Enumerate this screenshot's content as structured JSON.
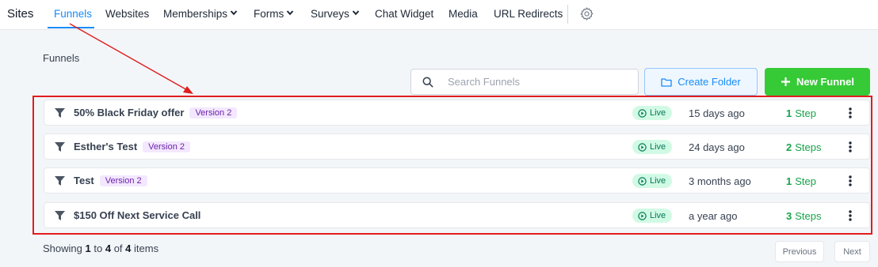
{
  "nav": {
    "brand": "Sites",
    "items": [
      {
        "label": "Funnels"
      },
      {
        "label": "Websites"
      },
      {
        "label": "Memberships"
      },
      {
        "label": "Forms"
      },
      {
        "label": "Surveys"
      },
      {
        "label": "Chat Widget"
      },
      {
        "label": "Media"
      },
      {
        "label": "URL Redirects"
      }
    ]
  },
  "section_title": "Funnels",
  "search": {
    "placeholder": "Search Funnels"
  },
  "buttons": {
    "create_folder": "Create Folder",
    "new_funnel": "New Funnel"
  },
  "funnels": [
    {
      "name": "50% Black Friday offer",
      "version": "Version 2",
      "status": "Live",
      "updated": "15 days ago",
      "step_count": "1",
      "step_label": "Step"
    },
    {
      "name": "Esther's Test",
      "version": "Version 2",
      "status": "Live",
      "updated": "24 days ago",
      "step_count": "2",
      "step_label": "Steps"
    },
    {
      "name": "Test",
      "version": "Version 2",
      "status": "Live",
      "updated": "3 months ago",
      "step_count": "1",
      "step_label": "Step"
    },
    {
      "name": "$150 Off Next Service Call",
      "version": "",
      "status": "Live",
      "updated": "a year ago",
      "step_count": "3",
      "step_label": "Steps"
    }
  ],
  "pagination": {
    "showing_prefix": "Showing",
    "from": "1",
    "to_word": "to",
    "to": "4",
    "of_word": "of",
    "total": "4",
    "items_word": "items",
    "previous": "Previous",
    "next": "Next"
  },
  "colors": {
    "accent": "#188bf6",
    "primary_button": "#37ca37",
    "live_badge_bg": "#d1fae5",
    "version_badge_bg": "#f3e8ff",
    "annotation_red": "#e11d1d"
  }
}
